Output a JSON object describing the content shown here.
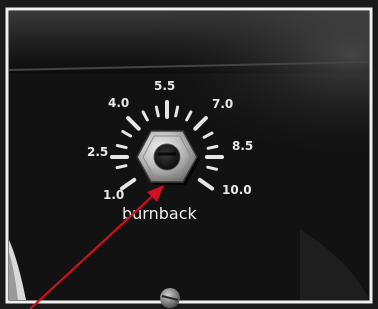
{
  "knob": {
    "scale_labels": [
      "1.0",
      "2.5",
      "4.0",
      "5.5",
      "7.0",
      "8.5",
      "10.0"
    ],
    "name_label": "burnback"
  },
  "colors": {
    "panel": "#111111",
    "frame_border": "#222222",
    "scale_ink": "#e9e9e9",
    "arrow": "#d01020"
  },
  "annotation": {
    "type": "arrow",
    "color": "#d01020"
  }
}
